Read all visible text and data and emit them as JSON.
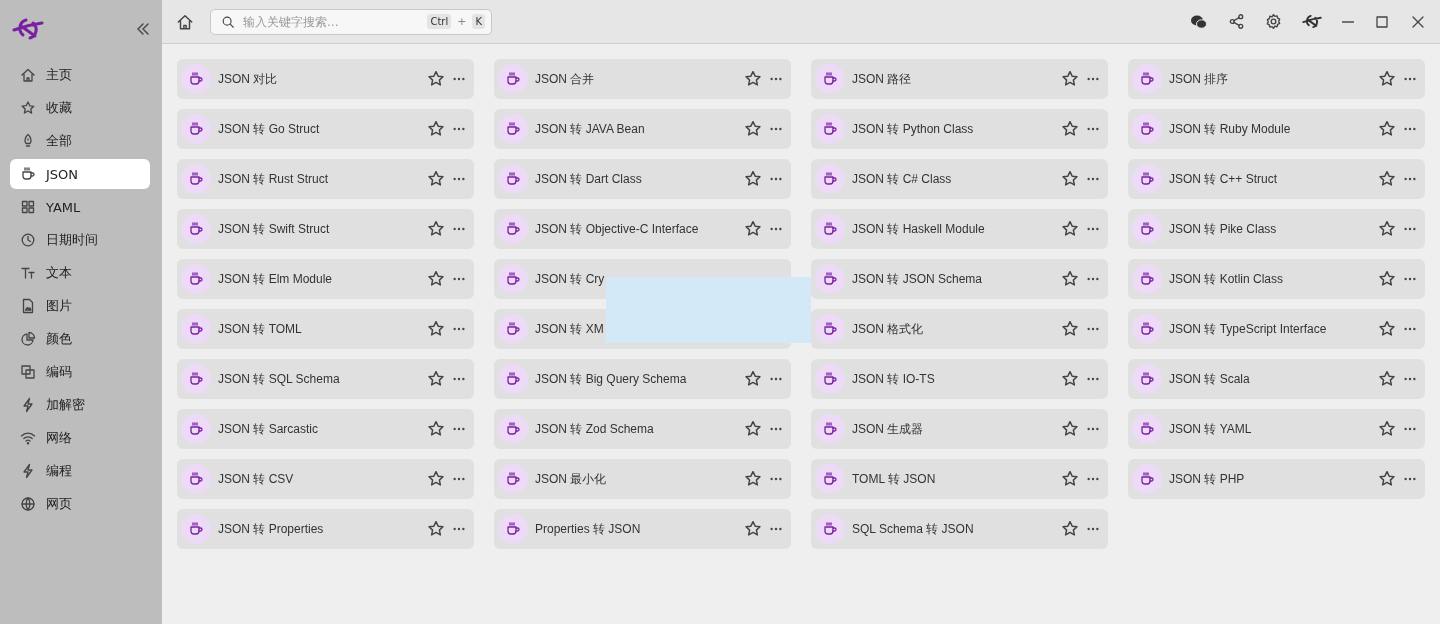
{
  "sidebar": {
    "items": [
      {
        "label": "主页",
        "selected": false
      },
      {
        "label": "收藏",
        "selected": false
      },
      {
        "label": "全部",
        "selected": false
      },
      {
        "label": "JSON",
        "selected": true
      },
      {
        "label": "YAML",
        "selected": false
      },
      {
        "label": "日期时间",
        "selected": false
      },
      {
        "label": "文本",
        "selected": false
      },
      {
        "label": "图片",
        "selected": false
      },
      {
        "label": "颜色",
        "selected": false
      },
      {
        "label": "编码",
        "selected": false
      },
      {
        "label": "加解密",
        "selected": false
      },
      {
        "label": "网络",
        "selected": false
      },
      {
        "label": "编程",
        "selected": false
      },
      {
        "label": "网页",
        "selected": false
      }
    ]
  },
  "toolbar": {
    "search": {
      "placeholder": "输入关键字搜索...",
      "shortcut": [
        "Ctrl",
        "+",
        "K"
      ]
    }
  },
  "tools": [
    {
      "title": "JSON 对比",
      "actions": true
    },
    {
      "title": "JSON 合并",
      "actions": true
    },
    {
      "title": "JSON 路径",
      "actions": true
    },
    {
      "title": "JSON 排序",
      "actions": true
    },
    {
      "title": "JSON 转 Go Struct",
      "actions": true
    },
    {
      "title": "JSON 转 JAVA Bean",
      "actions": true
    },
    {
      "title": "JSON 转 Python Class",
      "actions": true
    },
    {
      "title": "JSON 转 Ruby Module",
      "actions": true
    },
    {
      "title": "JSON 转 Rust Struct",
      "actions": true
    },
    {
      "title": "JSON 转 Dart Class",
      "actions": true
    },
    {
      "title": "JSON 转 C# Class",
      "actions": true
    },
    {
      "title": "JSON 转 C++ Struct",
      "actions": true
    },
    {
      "title": "JSON 转 Swift Struct",
      "actions": true
    },
    {
      "title": "JSON 转 Objective-C Interface",
      "actions": true
    },
    {
      "title": "JSON 转 Haskell Module",
      "actions": true
    },
    {
      "title": "JSON 转 Pike Class",
      "actions": true
    },
    {
      "title": "JSON 转 Elm Module",
      "actions": true
    },
    {
      "title": "JSON 转 Cry",
      "actions": false
    },
    {
      "title": "JSON 转 JSON Schema",
      "actions": true
    },
    {
      "title": "JSON 转 Kotlin Class",
      "actions": true
    },
    {
      "title": "JSON 转 TOML",
      "actions": true
    },
    {
      "title": "JSON 转 XM",
      "actions": false
    },
    {
      "title": "JSON 格式化",
      "actions": true
    },
    {
      "title": "JSON 转 TypeScript Interface",
      "actions": true
    },
    {
      "title": "JSON 转 SQL Schema",
      "actions": true
    },
    {
      "title": "JSON 转 Big Query Schema",
      "actions": true
    },
    {
      "title": "JSON 转 IO-TS",
      "actions": true
    },
    {
      "title": "JSON 转 Scala",
      "actions": true
    },
    {
      "title": "JSON 转 Sarcastic",
      "actions": true
    },
    {
      "title": "JSON 转 Zod Schema",
      "actions": true
    },
    {
      "title": "JSON 生成器",
      "actions": true
    },
    {
      "title": "JSON 转 YAML",
      "actions": true
    },
    {
      "title": "JSON 转 CSV",
      "actions": true
    },
    {
      "title": "JSON 最小化",
      "actions": true
    },
    {
      "title": "TOML 转 JSON",
      "actions": true
    },
    {
      "title": "JSON 转 PHP",
      "actions": true
    },
    {
      "title": "JSON 转 Properties",
      "actions": true
    },
    {
      "title": "Properties 转 JSON",
      "actions": true
    },
    {
      "title": "SQL Schema 转 JSON",
      "actions": true
    }
  ]
}
